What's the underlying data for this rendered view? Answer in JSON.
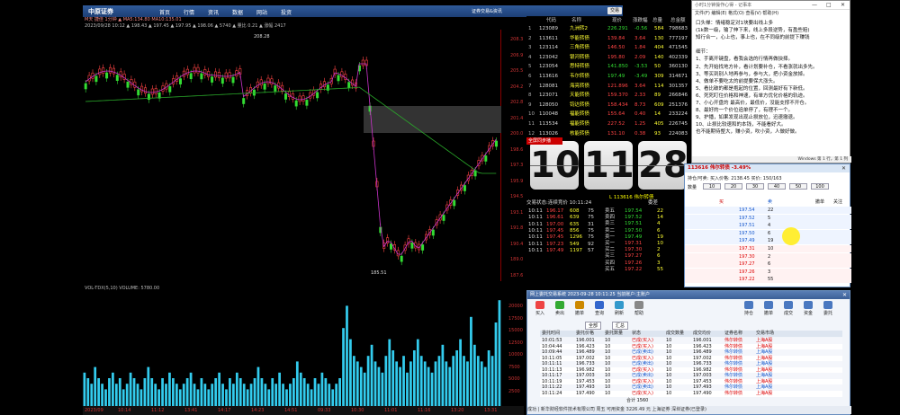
{
  "app": {
    "logo_text": "中原证券",
    "menu": [
      "首页",
      "行情",
      "资讯",
      "数据",
      "网站",
      "投资"
    ],
    "header_right": "证券交易&资讯",
    "header_button": "交易"
  },
  "top_info": {
    "line1": "M天 捷佳 1分钟 ▲ MA5:134.80 MA10:135.01",
    "line2": "2023/09/28 10:12 ▲ 198.43 ▲ 197.45 ▲ 197.95 ▲ 198.06 ▲ 5740 ▲ 量比 0.21 ▲ 涨幅 2417"
  },
  "kline": {
    "high_label": "208.28",
    "low_label": "185.51",
    "price_ticks": [
      "208.3",
      "206.9",
      "205.5",
      "204.2",
      "202.8",
      "201.4",
      "200.0",
      "198.6",
      "197.3",
      "195.9",
      "194.5",
      "193.1",
      "191.8",
      "190.4",
      "189.0",
      "187.6"
    ]
  },
  "volume": {
    "header": "VOL-TDX(5,10) VOLUME: 5780.00",
    "ticks": [
      "20000",
      "17500",
      "15000",
      "12500",
      "10000",
      "7500",
      "5000",
      "2500"
    ],
    "values": [
      6,
      5,
      4,
      7,
      5,
      4,
      3,
      5,
      6,
      4,
      5,
      3,
      4,
      6,
      5,
      4,
      3,
      5,
      7,
      5,
      4,
      3,
      5,
      4,
      6,
      5,
      4,
      3,
      4,
      5,
      6,
      4,
      3,
      5,
      4,
      3,
      4,
      5,
      6,
      4,
      3,
      5,
      4,
      6,
      5,
      4,
      3,
      4,
      5,
      7,
      5,
      4,
      3,
      5,
      4,
      6,
      4,
      3,
      4,
      5,
      8,
      6,
      5,
      4,
      3,
      5,
      4,
      6,
      5,
      4,
      3,
      4,
      5,
      14,
      18,
      12,
      9,
      8,
      7,
      6,
      9,
      11,
      8,
      7,
      6,
      9,
      12,
      10,
      8,
      7,
      9,
      6,
      8,
      10,
      12,
      9,
      8,
      7,
      6,
      8,
      9,
      11,
      8,
      7,
      9,
      10,
      12,
      9,
      8,
      16,
      11,
      9,
      8,
      7,
      10,
      9,
      15,
      19
    ]
  },
  "time_axis": [
    "2023/09",
    "10:14",
    "11:12",
    "13:41",
    "14:17",
    "14:23",
    "14:51",
    "09:33",
    "10:30",
    "11:01",
    "11:16",
    "13:20",
    "13:31"
  ],
  "quote_table": {
    "headers": [
      "代码",
      "名称",
      "",
      "现价",
      "涨跌幅",
      "总量",
      "总金额"
    ],
    "rows": [
      {
        "n": "1",
        "code": "123089",
        "name": "九洲转2",
        "price": "226.291",
        "pct": "-0.56",
        "vol": "584",
        "amt": "798683"
      },
      {
        "n": "2",
        "code": "113611",
        "name": "华能转债",
        "price": "139.84",
        "pct": "3.64",
        "vol": "130",
        "amt": "777197"
      },
      {
        "n": "3",
        "code": "123114",
        "name": "三角转债",
        "price": "146.50",
        "pct": "1.84",
        "vol": "404",
        "amt": "471545"
      },
      {
        "n": "4",
        "code": "123042",
        "name": "银河转债",
        "price": "195.80",
        "pct": "2.09",
        "vol": "140",
        "amt": "402339"
      },
      {
        "n": "5",
        "code": "123054",
        "name": "思特转债",
        "price": "141.850",
        "pct": "-3.53",
        "vol": "50",
        "amt": "360130"
      },
      {
        "n": "6",
        "code": "113616",
        "name": "韦尔转债",
        "price": "197.49",
        "pct": "-3.49",
        "vol": "309",
        "amt": "314671"
      },
      {
        "n": "7",
        "code": "128081",
        "name": "海亮转债",
        "price": "121.896",
        "pct": "3.64",
        "vol": "114",
        "amt": "301357"
      },
      {
        "n": "8",
        "code": "123071",
        "name": "天能转债",
        "price": "159.370",
        "pct": "2.33",
        "vol": "89",
        "amt": "266846"
      },
      {
        "n": "9",
        "code": "128050",
        "name": "钧达转债",
        "price": "158.434",
        "pct": "8.73",
        "vol": "609",
        "amt": "251376"
      },
      {
        "n": "10",
        "code": "110048",
        "name": "福能转债",
        "price": "155.64",
        "pct": "0.40",
        "vol": "14",
        "amt": "233224"
      },
      {
        "n": "11",
        "code": "113534",
        "name": "福能转债",
        "price": "227.52",
        "pct": "1.25",
        "vol": "405",
        "amt": "226745"
      },
      {
        "n": "12",
        "code": "113026",
        "name": "核能转债",
        "price": "131.10",
        "pct": "0.38",
        "vol": "93",
        "amt": "224083"
      }
    ]
  },
  "notepad": {
    "title": "小时1分钟操作心得 - 记事本",
    "menu": "文件(F)  编辑(E)  格式(O)  查看(V)  帮助(H)",
    "lines": [
      "口头禅：情绪稳定对1块要出线上多",
      "(1k数一级，输了伸下来，线上多段逆势，有盈些赔)",
      "知行合一，心上也，事上也，在不同级的前提下赚钱",
      "",
      "细节：",
      "1、手离开键盘，看我会选的行情再做抉择。",
      "2、先开始找地方补，看计划要补仓，不看涨就出多先。",
      "3、等买到别人地再参与，参与大，把小资金放掉。",
      "4、做单不要吃太的前提要保大涨头。",
      "5、看比破的都是抱起的位置，回测最好有下新低。",
      "6、死死盯住价格和神速，有单方优化价格的轨迹。",
      "7、小心开盘的 最高价，最低价，没能支撑不开仓。",
      "8、最好的一个价位追单停了，有理不一个。",
      "9、护播，如果发现出现止损放位，迅速撤退。",
      "10、止损比较速和的本钱，不能看好大。",
      "也不能期待整大，赚小资，吹小资，人做好做。"
    ],
    "status": "Windows    第 1 行，第 1 列"
  },
  "clock": {
    "caption": "全屏同步播",
    "hour": "10",
    "minute": "11",
    "second": "28"
  },
  "stock_label": "L 113616 伟尔转债",
  "trade_log": {
    "header": "交易状态:连续竞价 10:11:24",
    "rows": [
      {
        "t": "10:11",
        "p": "196.17",
        "v": "608",
        "f": "75"
      },
      {
        "t": "10:11",
        "p": "196.61",
        "v": "639",
        "f": "75"
      },
      {
        "t": "10:11",
        "p": "197.00",
        "v": "635",
        "f": "31"
      },
      {
        "t": "10:11",
        "p": "197.45",
        "v": "856",
        "f": "75"
      },
      {
        "t": "10:11",
        "p": "197.45",
        "v": "1296",
        "f": "75"
      },
      {
        "t": "10:11",
        "p": "197.23",
        "v": "549",
        "f": "92"
      },
      {
        "t": "10:11",
        "p": "197.49",
        "v": "1197",
        "f": "57"
      }
    ]
  },
  "order_book": {
    "header": "委差",
    "asks": [
      {
        "lvl": "卖五",
        "p": "197.54",
        "v": "22"
      },
      {
        "lvl": "卖四",
        "p": "197.52",
        "v": "14"
      },
      {
        "lvl": "卖三",
        "p": "197.51",
        "v": "4"
      },
      {
        "lvl": "卖二",
        "p": "197.50",
        "v": "6"
      },
      {
        "lvl": "卖一",
        "p": "197.49",
        "v": "19"
      }
    ],
    "bids": [
      {
        "lvl": "买一",
        "p": "197.31",
        "v": "10"
      },
      {
        "lvl": "买二",
        "p": "197.30",
        "v": "2"
      },
      {
        "lvl": "买三",
        "p": "197.27",
        "v": "6"
      },
      {
        "lvl": "买四",
        "p": "197.26",
        "v": "3"
      },
      {
        "lvl": "买五",
        "p": "197.22",
        "v": "55"
      }
    ]
  },
  "dom": {
    "title": "113616  伟尔转债  -3.49%",
    "account_line": "持仓/可卖: 买入价格: 2138.45    买价: 150/163",
    "qty_label": "数量",
    "qty_options": [
      "10",
      "20",
      "30",
      "40",
      "50",
      "100"
    ],
    "rows": [
      {
        "p": "197.54",
        "v": "22"
      },
      {
        "p": "197.52",
        "v": "5"
      },
      {
        "p": "197.51",
        "v": "4"
      },
      {
        "p": "197.50",
        "v": "6"
      },
      {
        "p": "197.49",
        "v": "19"
      },
      {
        "p": "197.31",
        "v": "10"
      },
      {
        "p": "197.30",
        "v": "2"
      },
      {
        "p": "197.27",
        "v": "6"
      },
      {
        "p": "197.26",
        "v": "3"
      },
      {
        "p": "197.22",
        "v": "55"
      }
    ],
    "col_buy": "买",
    "col_sell": "卖",
    "col_cancel": "撤单",
    "col_fav": "关注"
  },
  "broker": {
    "title": "网上委托交易系统  2023-09-28 10:11:25  当前账户:主账户",
    "toolbar": [
      "买入",
      "卖出",
      "撤单",
      "查询",
      "刷新",
      "帮助"
    ],
    "toolbar_right": [
      "持仓",
      "撤单",
      "成交",
      "资金",
      "委托"
    ],
    "filter": [
      "全部",
      "汇总"
    ],
    "headers": [
      "委托时间",
      "委托价格",
      "委托数量",
      "状态",
      "成交数量",
      "成交均价",
      "证券名称",
      "交易市场"
    ],
    "rows": [
      {
        "t": "10:01:53",
        "p": "196.001",
        "q": "10",
        "s": "已成(买入)",
        "d": "10",
        "a": "196.001",
        "n": "伟尔转债",
        "m": "上海A股"
      },
      {
        "t": "10:04:44",
        "p": "196.423",
        "q": "10",
        "s": "已成(买入)",
        "d": "10",
        "a": "196.423",
        "n": "伟尔转债",
        "m": "上海A股"
      },
      {
        "t": "10:09:44",
        "p": "196.489",
        "q": "10",
        "s": "已成(卖出)",
        "d": "10",
        "a": "196.489",
        "n": "伟尔转债",
        "m": "上海A股"
      },
      {
        "t": "10:11:05",
        "p": "197.002",
        "q": "10",
        "s": "已成(买入)",
        "d": "10",
        "a": "197.002",
        "n": "伟尔转债",
        "m": "上海A股"
      },
      {
        "t": "10:11:11",
        "p": "196.733",
        "q": "10",
        "s": "已成(卖出)",
        "d": "10",
        "a": "196.733",
        "n": "伟尔转债",
        "m": "上海A股"
      },
      {
        "t": "10:11:13",
        "p": "196.982",
        "q": "10",
        "s": "已成(买入)",
        "d": "10",
        "a": "196.982",
        "n": "伟尔转债",
        "m": "上海A股"
      },
      {
        "t": "10:11:17",
        "p": "197.003",
        "q": "10",
        "s": "已成(卖出)",
        "d": "10",
        "a": "197.003",
        "n": "伟尔转债",
        "m": "上海A股"
      },
      {
        "t": "10:11:19",
        "p": "197.453",
        "q": "10",
        "s": "已成(买入)",
        "d": "10",
        "a": "197.453",
        "n": "伟尔转债",
        "m": "上海A股"
      },
      {
        "t": "10:11:22",
        "p": "197.493",
        "q": "10",
        "s": "已成(卖出)",
        "d": "10",
        "a": "197.493",
        "n": "伟尔转债",
        "m": "上海A股"
      },
      {
        "t": "10:11:24",
        "p": "197.490",
        "q": "10",
        "s": "已成(买入)",
        "d": "10",
        "a": "197.490",
        "n": "伟尔转债",
        "m": "上海A股"
      }
    ],
    "footer_total": "合计  1560",
    "status": "成功 | 新华财经软件技术有限公司    周五    可用资金  3226.49 元    上海证券    深圳证券(已登录)"
  },
  "colors": {
    "up": "#ff4444",
    "down": "#33dd33",
    "ma_long": "#2aaa2a",
    "ma_short": "#cc33cc",
    "vol_bar": "#33ccee"
  }
}
